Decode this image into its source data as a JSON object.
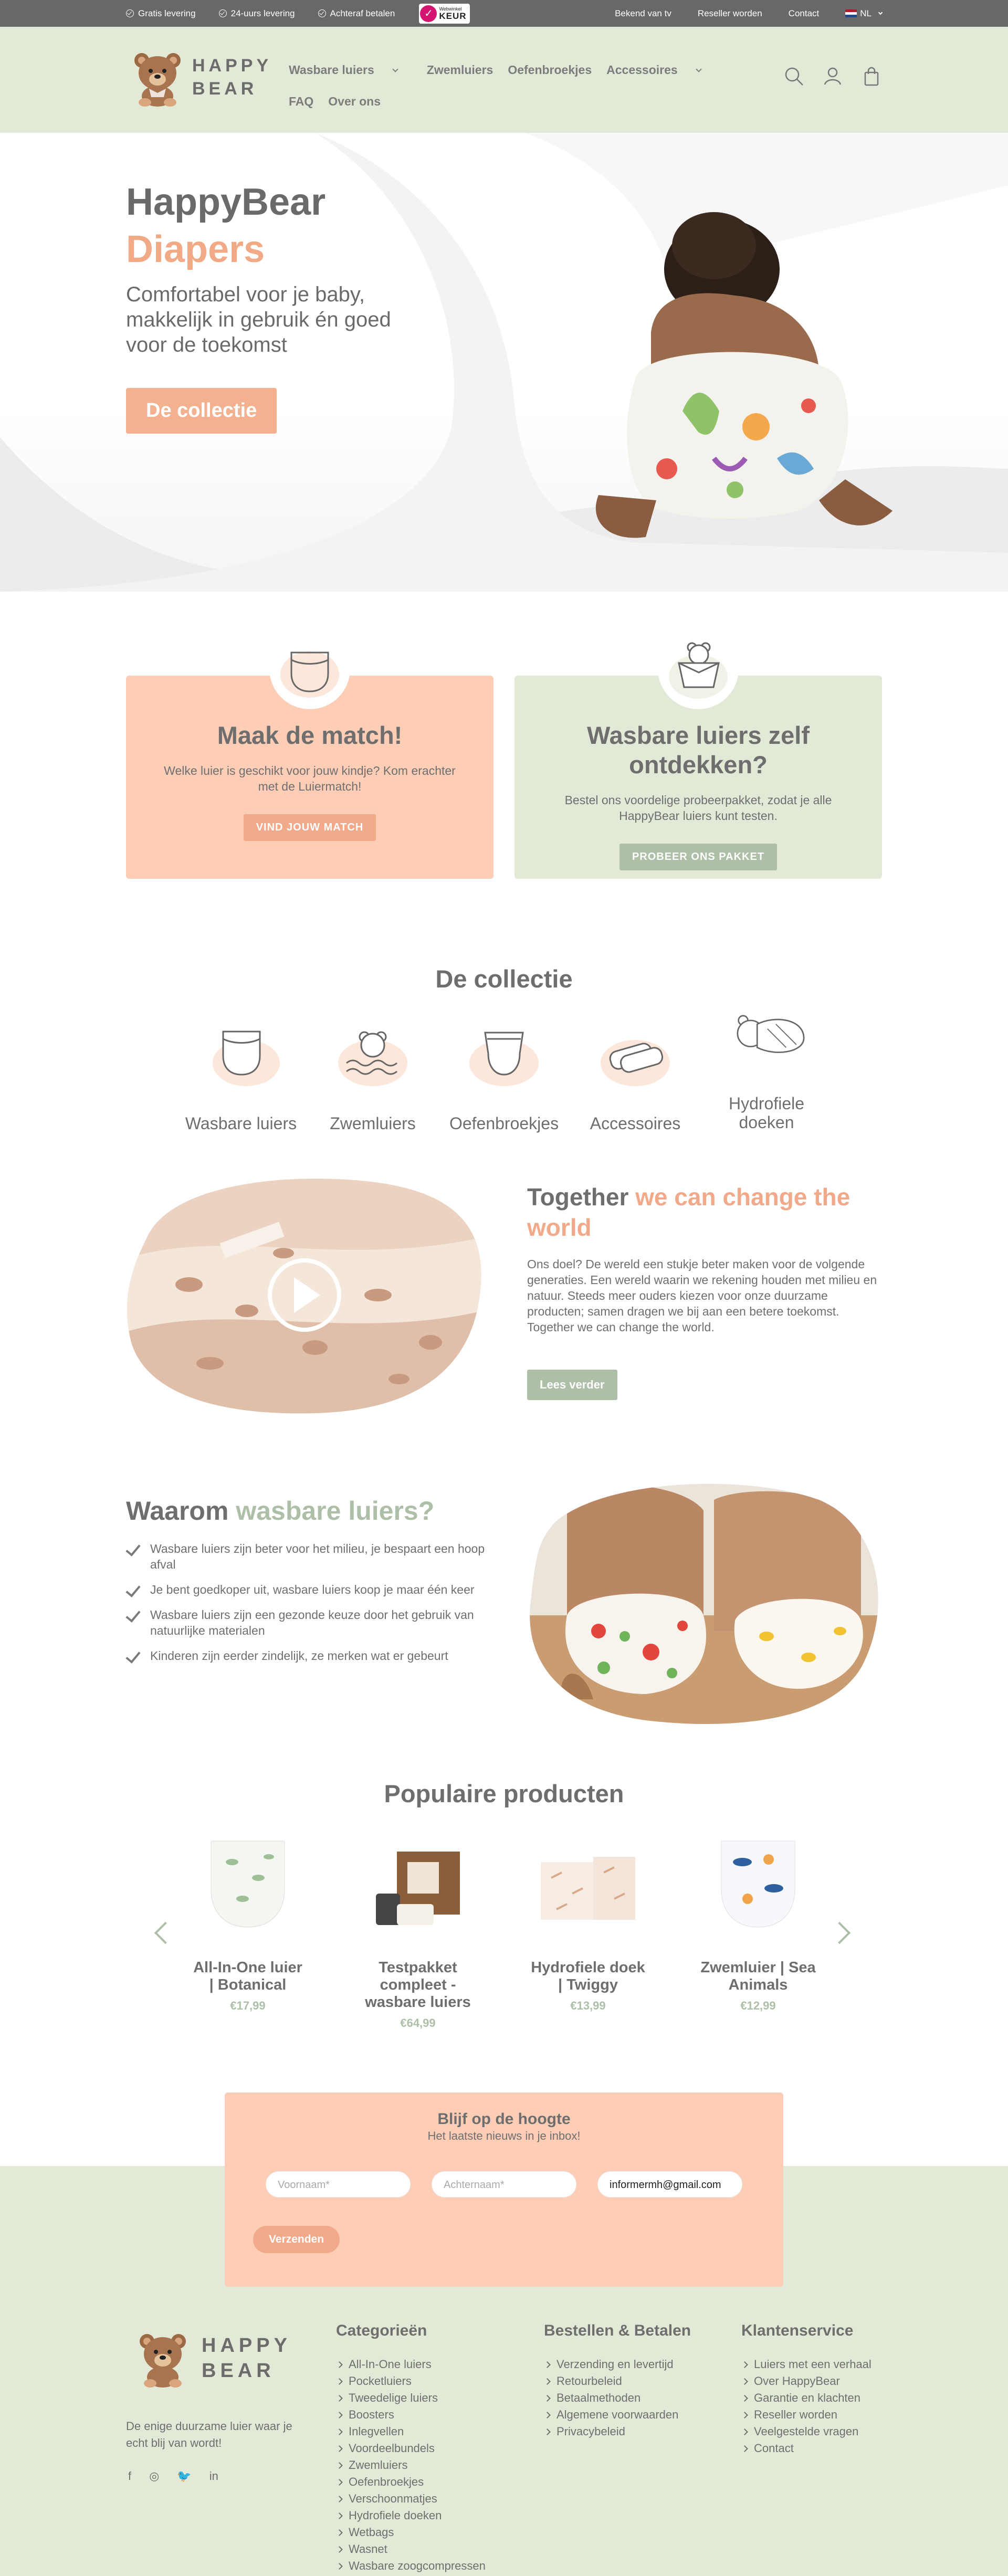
{
  "topbar": {
    "usps": [
      "Gratis levering",
      "24-uurs levering",
      "Achteraf betalen"
    ],
    "keur_label": "KEUR",
    "keur_top": "Webwinkel",
    "links": [
      "Bekend van tv",
      "Reseller worden",
      "Contact"
    ],
    "language": "NL"
  },
  "header": {
    "logo_line1": "HAPPY",
    "logo_line2": "BEAR",
    "nav": [
      "Wasbare luiers",
      "Zwemluiers",
      "Oefenbroekjes",
      "Accessoires",
      "FAQ",
      "Over ons"
    ],
    "icons": [
      "search-icon",
      "account-icon",
      "cart-icon"
    ]
  },
  "hero": {
    "title_line1": "HappyBear",
    "title_line2": "Diapers",
    "subtitle": "Comfortabel voor je baby, makkelijk in gebruik én goed voor de toekomst",
    "button": "De collectie"
  },
  "cards": [
    {
      "title": "Maak de match!",
      "text": "Welke luier is geschikt voor jouw kindje? Kom erachter met de Luiermatch!",
      "button": "VIND JOUW MATCH"
    },
    {
      "title": "Wasbare luiers zelf ontdekken?",
      "text": "Bestel ons voordelige probeerpakket, zodat je alle HappyBear luiers kunt testen.",
      "button": "PROBEER ONS PAKKET"
    }
  ],
  "collection": {
    "title": "De collectie",
    "categories": [
      "Wasbare luiers",
      "Zwemluiers",
      "Oefenbroekjes",
      "Accessoires",
      "Hydrofiele doeken"
    ]
  },
  "together": {
    "title_plain": "Together ",
    "title_accent": "we can change the world",
    "text": "Ons doel? De wereld een stukje beter maken voor de volgende generaties. Een wereld waarin we rekening houden met milieu en natuur. Steeds meer ouders kiezen voor onze duurzame producten; samen dragen we bij aan een betere toekomst. Together we can change the world.",
    "button": "Lees verder"
  },
  "why": {
    "title_plain": "Waarom ",
    "title_accent": "wasbare luiers?",
    "items": [
      "Wasbare luiers zijn beter voor het milieu, je bespaart een hoop afval",
      "Je bent goedkoper uit, wasbare luiers koop je maar één keer",
      "Wasbare luiers zijn een gezonde keuze door het gebruik van natuurlijke materialen",
      "Kinderen zijn eerder zindelijk, ze merken wat er gebeurt"
    ]
  },
  "products": {
    "title": "Populaire producten",
    "items": [
      {
        "name": "All-In-One luier | Botanical",
        "price": "€17,99"
      },
      {
        "name": "Testpakket compleet - wasbare luiers",
        "price": "€64,99"
      },
      {
        "name": "Hydrofiele doek | Twiggy",
        "price": "€13,99"
      },
      {
        "name": "Zwemluier | Sea Animals",
        "price": "€12,99"
      }
    ]
  },
  "newsletter": {
    "title": "Blijf op de hoogte",
    "subtitle": "Het laatste nieuws in je inbox!",
    "firstname_placeholder": "Voornaam*",
    "lastname_placeholder": "Achternaam*",
    "email_value": "informermh@gmail.com",
    "button": "Verzenden"
  },
  "footer": {
    "tagline": "De enige duurzame luier waar je echt blij van wordt!",
    "social": [
      "facebook-icon",
      "instagram-icon",
      "twitter-icon",
      "linkedin-icon"
    ],
    "columns": [
      {
        "title": "Categorieën",
        "links": [
          "All-In-One luiers",
          "Pocketluiers",
          "Tweedelige luiers",
          "Boosters",
          "Inlegvellen",
          "Voordeelbundels",
          "Zwemluiers",
          "Oefenbroekjes",
          "Verschoonmatjes",
          "Hydrofiele doeken",
          "Wetbags",
          "Wasnet",
          "Wasbare zoogcompressen"
        ]
      },
      {
        "title": "Bestellen & Betalen",
        "links": [
          "Verzending en levertijd",
          "Retourbeleid",
          "Betaalmethoden",
          "Algemene voorwaarden",
          "Privacybeleid"
        ]
      },
      {
        "title": "Klantenservice",
        "links": [
          "Luiers met een verhaal",
          "Over HappyBear",
          "Garantie en klachten",
          "Reseller worden",
          "Veelgestelde vragen",
          "Contact"
        ]
      }
    ]
  },
  "colors": {
    "sage": "#e2e9d6",
    "peach": "#fdcdb6",
    "accent": "#f2a98a",
    "green_button": "#aebfa8",
    "topbar": "#686868"
  }
}
